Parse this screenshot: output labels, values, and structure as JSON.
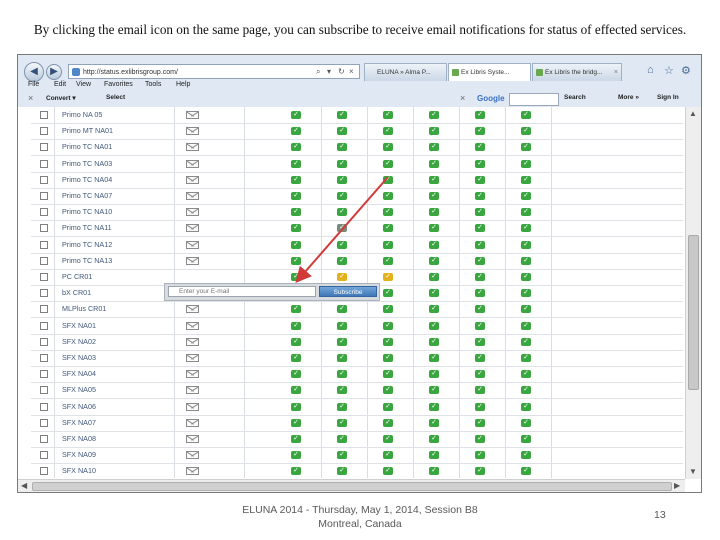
{
  "slide": {
    "heading": "By clicking the email icon on the same page, you can subscribe to receive email notifications for status of effected services.",
    "footer_line1": "ELUNA 2014 - Thursday, May 1, 2014, Session B8",
    "footer_line2": "Montreal, Canada",
    "page_number": "13"
  },
  "browser": {
    "address_url": "http://status.exlibrisgroup.com/",
    "address_search_glyph": "⌕",
    "address_stop_glyph": "▾",
    "address_refresh_glyph": "↻",
    "address_close_glyph": "×",
    "tabs": [
      {
        "label": "ELUNA » Alma P..."
      },
      {
        "label": "Ex Libris Syste..."
      },
      {
        "label": "Ex Libris the bridg..."
      }
    ],
    "home_glyph": "⌂",
    "star_glyph": "☆",
    "settings_glyph": "⚙",
    "menu": [
      "File",
      "Edit",
      "View",
      "Favorites",
      "Tools",
      "Help"
    ],
    "toolbar": {
      "convert_label": "Convert",
      "select_label": "Select",
      "close_x": "×",
      "google_label": "Google",
      "search_label": "Search",
      "more_label": "More »",
      "signin_label": "Sign In"
    }
  },
  "status_table": {
    "rows": [
      {
        "name": "Primo NA 05",
        "cols": [
          "ok",
          "ok",
          "ok",
          "ok",
          "ok",
          "ok"
        ]
      },
      {
        "name": "Primo MT NA01",
        "cols": [
          "ok",
          "ok",
          "ok",
          "ok",
          "ok",
          "ok"
        ]
      },
      {
        "name": "Primo TC NA01",
        "cols": [
          "ok",
          "ok",
          "ok",
          "ok",
          "ok",
          "ok"
        ]
      },
      {
        "name": "Primo TC NA03",
        "cols": [
          "ok",
          "ok",
          "ok",
          "ok",
          "ok",
          "ok"
        ]
      },
      {
        "name": "Primo TC NA04",
        "cols": [
          "ok",
          "ok",
          "ok",
          "ok",
          "ok",
          "ok"
        ]
      },
      {
        "name": "Primo TC NA07",
        "cols": [
          "ok",
          "ok",
          "ok",
          "ok",
          "ok",
          "ok"
        ]
      },
      {
        "name": "Primo TC NA10",
        "cols": [
          "ok",
          "ok",
          "ok",
          "ok",
          "ok",
          "ok"
        ]
      },
      {
        "name": "Primo TC NA11",
        "cols": [
          "ok",
          "grey",
          "ok",
          "ok",
          "ok",
          "ok"
        ]
      },
      {
        "name": "Primo TC NA12",
        "cols": [
          "ok",
          "ok",
          "ok",
          "ok",
          "ok",
          "ok"
        ]
      },
      {
        "name": "Primo TC NA13",
        "cols": [
          "ok",
          "ok",
          "ok",
          "ok",
          "ok",
          "ok"
        ]
      },
      {
        "name": "PC CR01",
        "cols": [
          "ok",
          "warn",
          "warn",
          "ok",
          "ok",
          "ok"
        ]
      },
      {
        "name": "bX CR01",
        "cols": [
          "ok",
          "ok",
          "ok",
          "ok",
          "ok",
          "ok"
        ]
      },
      {
        "name": "MLPlus CR01",
        "cols": [
          "ok",
          "ok",
          "ok",
          "ok",
          "ok",
          "ok"
        ]
      },
      {
        "name": "SFX NA01",
        "cols": [
          "ok",
          "ok",
          "ok",
          "ok",
          "ok",
          "ok"
        ]
      },
      {
        "name": "SFX NA02",
        "cols": [
          "ok",
          "ok",
          "ok",
          "ok",
          "ok",
          "ok"
        ]
      },
      {
        "name": "SFX NA03",
        "cols": [
          "ok",
          "ok",
          "ok",
          "ok",
          "ok",
          "ok"
        ]
      },
      {
        "name": "SFX NA04",
        "cols": [
          "ok",
          "ok",
          "ok",
          "ok",
          "ok",
          "ok"
        ]
      },
      {
        "name": "SFX NA05",
        "cols": [
          "ok",
          "ok",
          "ok",
          "ok",
          "ok",
          "ok"
        ]
      },
      {
        "name": "SFX NA06",
        "cols": [
          "ok",
          "ok",
          "ok",
          "ok",
          "ok",
          "ok"
        ]
      },
      {
        "name": "SFX NA07",
        "cols": [
          "ok",
          "ok",
          "ok",
          "ok",
          "ok",
          "ok"
        ]
      },
      {
        "name": "SFX NA08",
        "cols": [
          "ok",
          "ok",
          "ok",
          "ok",
          "ok",
          "ok"
        ]
      },
      {
        "name": "SFX NA09",
        "cols": [
          "ok",
          "ok",
          "ok",
          "ok",
          "ok",
          "ok"
        ]
      },
      {
        "name": "SFX NA10",
        "cols": [
          "ok",
          "ok",
          "ok",
          "ok",
          "ok",
          "ok"
        ]
      }
    ],
    "check_glyph": "✓"
  },
  "subscribe_popup": {
    "placeholder": "Enter your E-mail",
    "button_label": "Subscribe"
  },
  "colors": {
    "status_ok": "#3aa640",
    "status_warning": "#e3b11c",
    "arrow": "#d23a3a",
    "subscribe_button": "#3f78b8"
  }
}
